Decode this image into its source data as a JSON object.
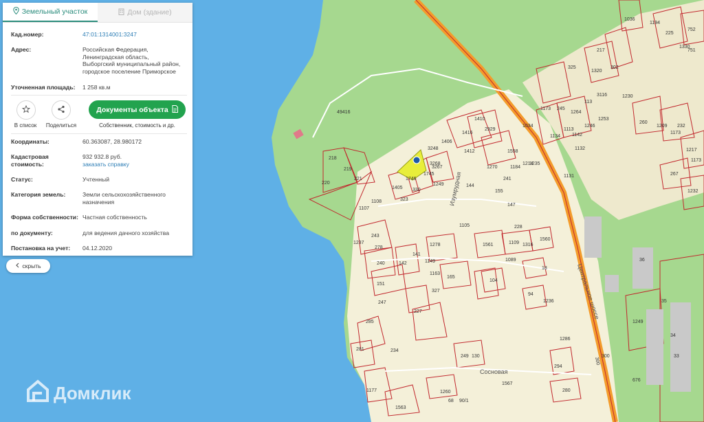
{
  "tabs": [
    {
      "label": "Земельный участок",
      "icon": "pin-icon"
    },
    {
      "label": "Дом (здание)",
      "icon": "building-icon"
    }
  ],
  "plot": {
    "cadastral_label": "Кад.номер:",
    "cadastral_value": "47:01:1314001:3247",
    "address_label": "Адрес:",
    "address_lines": [
      "Российская Федерация,",
      "Ленинградская область,",
      "Выборгский муниципальный район,",
      "городское поселение Приморское"
    ],
    "area_label": "Уточненная площадь:",
    "area_value": "1 258 кв.м",
    "coords_label": "Координаты:",
    "coords_value": "60.363087, 28.980172",
    "cost_label_1": "Кадастровая",
    "cost_label_2": "стоимость:",
    "cost_value": "932 932.8 руб.",
    "cost_link": "заказать справку",
    "status_label": "Статус:",
    "status_value": "Учтенный",
    "category_label": "Категория земель:",
    "category_lines": [
      "Земли сельскохозяйственного",
      "назначения"
    ],
    "ownership_label": "Форма собственности:",
    "ownership_value": "Частная собственность",
    "doc_label": "по документу:",
    "doc_value": "для ведения дачного хозяйства",
    "registered_label": "Постановка на учет:",
    "registered_value": "04.12.2020"
  },
  "actions": {
    "favorite_label": "В список",
    "share_label": "Поделиться",
    "documents_button": "Документы объекта",
    "documents_sub": "Собственник, стоимость и др."
  },
  "hide_label": "скрыть",
  "logo_text": "Домклик",
  "map": {
    "street_labels": [
      "Изумрудная",
      "Центральное шоссе",
      "Сосновая"
    ],
    "road_number": "300",
    "parcel_numbers": [
      "49416",
      "218",
      "219",
      "220",
      "221",
      "1405",
      "1746",
      "323",
      "330",
      "3248",
      "3268",
      "1249",
      "1745",
      "3267",
      "1410",
      "1416",
      "1406",
      "1412",
      "2929",
      "1558",
      "1270",
      "1214",
      "1184",
      "241",
      "155",
      "144",
      "1107",
      "1108",
      "1237",
      "243",
      "278",
      "240",
      "151",
      "142",
      "141",
      "1149",
      "1278",
      "1163",
      "327",
      "165",
      "104",
      "1561",
      "1109",
      "1316",
      "1560",
      "1089",
      "18",
      "228",
      "147",
      "247",
      "227",
      "285",
      "281",
      "234",
      "249",
      "130",
      "1260",
      "68",
      "90/1",
      "1563",
      "1177",
      "280",
      "294",
      "1567",
      "1286",
      "94",
      "1236",
      "1235",
      "1131",
      "1132",
      "1142",
      "1134",
      "1113",
      "245",
      "1264",
      "1246",
      "1253",
      "1034",
      "1173",
      "113",
      "3116",
      "1230",
      "217",
      "1320",
      "302",
      "1194",
      "1036",
      "225",
      "1330",
      "752",
      "751",
      "1209",
      "232",
      "260",
      "267",
      "1217",
      "1173",
      "1232",
      "36",
      "35",
      "34",
      "33",
      "1249",
      "676",
      "1105",
      "300",
      "325",
      "1173"
    ],
    "colors": {
      "water": "#5fb0e6",
      "forest": "#a6d88f",
      "settlement": "#f4f0d9",
      "parcel": "#c1272d",
      "road": "#f39c2c",
      "selected": "#e8ee3a"
    }
  }
}
